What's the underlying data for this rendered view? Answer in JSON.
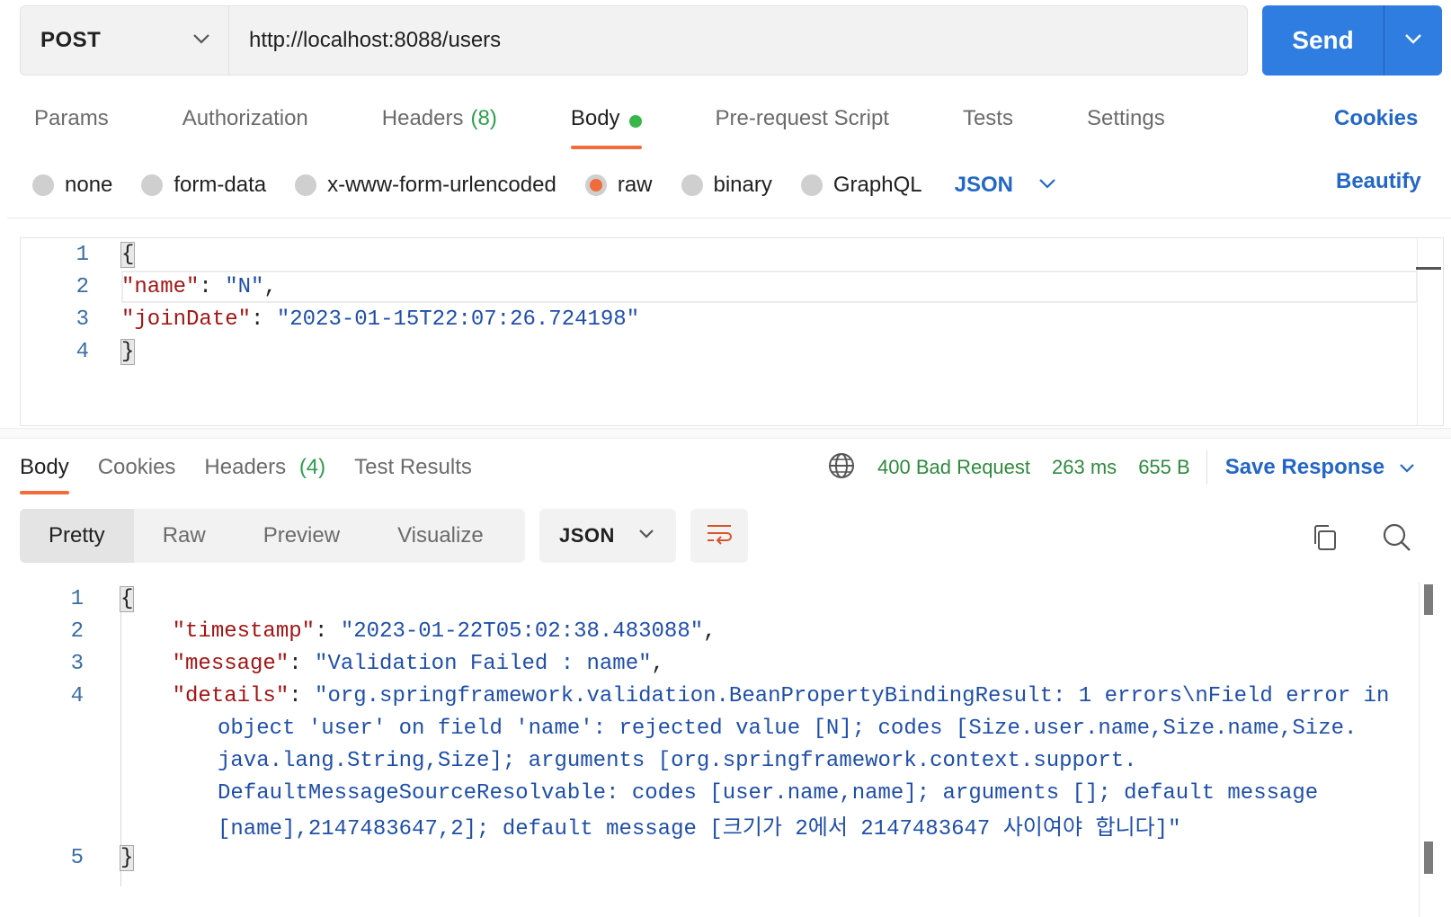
{
  "request": {
    "method": "POST",
    "url": "http://localhost:8088/users",
    "send_label": "Send"
  },
  "request_tabs": {
    "params": "Params",
    "authorization": "Authorization",
    "headers": "Headers",
    "headers_count": "(8)",
    "body": "Body",
    "pre_request": "Pre-request Script",
    "tests": "Tests",
    "settings": "Settings",
    "cookies": "Cookies"
  },
  "body_types": {
    "none": "none",
    "form_data": "form-data",
    "urlencoded": "x-www-form-urlencoded",
    "raw": "raw",
    "binary": "binary",
    "graphql": "GraphQL",
    "selected": "raw",
    "language": "JSON",
    "beautify": "Beautify"
  },
  "request_body": {
    "line_numbers": [
      "1",
      "2",
      "3",
      "4"
    ],
    "open_brace": "{",
    "close_brace": "}",
    "name_key": "\"name\"",
    "name_value": "\"N\"",
    "join_key": "\"joinDate\"",
    "join_value": "\"2023-01-15T22:07:26.724198\""
  },
  "response_tabs": {
    "body": "Body",
    "cookies": "Cookies",
    "headers": "Headers",
    "headers_count": "(4)",
    "test_results": "Test Results"
  },
  "response_meta": {
    "status": "400 Bad Request",
    "time": "263 ms",
    "size": "655 B",
    "save_response": "Save Response"
  },
  "response_toolbar": {
    "pretty": "Pretty",
    "raw": "Raw",
    "preview": "Preview",
    "visualize": "Visualize",
    "format": "JSON"
  },
  "response_body": {
    "line_numbers": [
      "1",
      "2",
      "3",
      "4",
      "5"
    ],
    "open_brace": "{",
    "close_brace": "}",
    "timestamp_key": "\"timestamp\"",
    "timestamp_value": "\"2023-01-22T05:02:38.483088\"",
    "message_key": "\"message\"",
    "message_value": "\"Validation Failed : name\"",
    "details_key": "\"details\"",
    "details_lines": [
      "\"org.springframework.validation.BeanPropertyBindingResult: 1 errors\\nField error in",
      "object 'user' on field 'name': rejected value [N]; codes [Size.user.name,Size.name,Size.",
      "java.lang.String,Size]; arguments [org.springframework.context.support.",
      "DefaultMessageSourceResolvable: codes [user.name,name]; arguments []; default message",
      "[name],2147483647,2]; default message [크기가 2에서 2147483647 사이여야 합니다]\""
    ]
  },
  "colors": {
    "accent": "#f26b3a",
    "brand_blue": "#2f7de1",
    "link_blue": "#2367c6",
    "status_green": "#2e8a3e"
  }
}
